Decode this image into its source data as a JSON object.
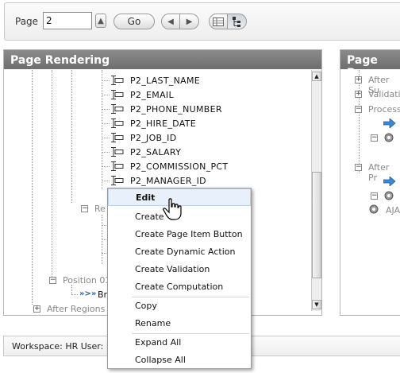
{
  "toolbar": {
    "page_label": "Page",
    "page_value": "2",
    "go_label": "Go"
  },
  "left_panel": {
    "title": "Page Rendering",
    "items": [
      {
        "label": "P2_LAST_NAME"
      },
      {
        "label": "P2_EMAIL"
      },
      {
        "label": "P2_PHONE_NUMBER"
      },
      {
        "label": "P2_HIRE_DATE"
      },
      {
        "label": "P2_JOB_ID"
      },
      {
        "label": "P2_SALARY"
      },
      {
        "label": "P2_COMMISSION_PCT"
      },
      {
        "label": "P2_MANAGER_ID"
      }
    ],
    "partial_re": "Re",
    "position_label": "Position 01",
    "br_label": "Br",
    "after_regions": "After Regions"
  },
  "right_panel": {
    "title": "Page Proc",
    "items": [
      "After Su",
      "Validatio",
      "Process",
      "After Pr",
      "AJA"
    ]
  },
  "context_menu": {
    "items": [
      "Edit",
      "Create",
      "Create Page Item Button",
      "Create Dynamic Action",
      "Create Validation",
      "Create Computation",
      "Copy",
      "Rename",
      "Expand All",
      "Collapse All"
    ],
    "highlighted": "Edit"
  },
  "statusbar": {
    "text": "Workspace: HR User: H"
  }
}
